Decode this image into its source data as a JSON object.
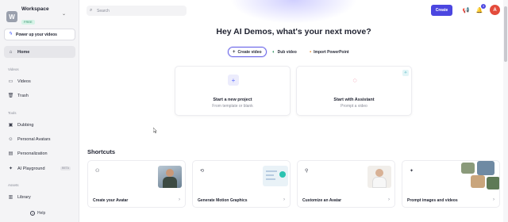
{
  "workspace": {
    "name": "Workspace",
    "badge": "FREE",
    "initial": "W"
  },
  "sidebar": {
    "power_button": "Power up your videos",
    "home": "Home",
    "sections": {
      "videos": "Videos",
      "tools": "Tools",
      "assets": "Assets"
    },
    "videos_items": [
      "Videos",
      "Trash"
    ],
    "tools_items": [
      "Dubbing",
      "Personal Avatars",
      "Personalization",
      "AI Playground"
    ],
    "beta": "BETA",
    "assets_items": [
      "Library"
    ],
    "help": "Help"
  },
  "header": {
    "search_placeholder": "Search",
    "create_label": "Create",
    "notification_count": "3",
    "user_initial": "A"
  },
  "hero": {
    "title": "Hey AI Demos, what's your next move?",
    "pills": [
      "Create video",
      "Dub video",
      "Import PowerPoint"
    ]
  },
  "cards": [
    {
      "title": "Start a new project",
      "subtitle": "From template or blank"
    },
    {
      "title": "Start with Assistant",
      "subtitle": "Prompt a video"
    }
  ],
  "shortcuts": {
    "title": "Shortcuts",
    "items": [
      "Create your Avatar",
      "Generate Motion Graphics",
      "Customize an Avatar",
      "Prompt images and videos"
    ]
  },
  "colors": {
    "accent": "#4b46e0",
    "user_avatar": "#e34b3b"
  }
}
